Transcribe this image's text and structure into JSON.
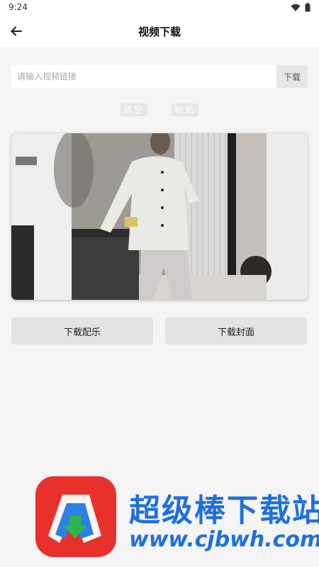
{
  "status": {
    "time": "9:24"
  },
  "header": {
    "title": "视频下载"
  },
  "search": {
    "placeholder": "请输入视频链接",
    "value": "",
    "download_label": "下载"
  },
  "mini_buttons": {
    "clear_label": "清空",
    "paste_label": "粘贴"
  },
  "actions": {
    "music_label": "下载配乐",
    "cover_label": "下载封面"
  },
  "watermark": {
    "title": "超级棒下载站",
    "url": "www.cjbwh.com"
  },
  "colors": {
    "accent": "#1f6fe0",
    "logo_red": "#e8312a",
    "background": "#f4f4f4"
  },
  "icons": {
    "back": "arrow-left-icon",
    "wifi": "wifi-icon",
    "battery": "battery-icon"
  }
}
